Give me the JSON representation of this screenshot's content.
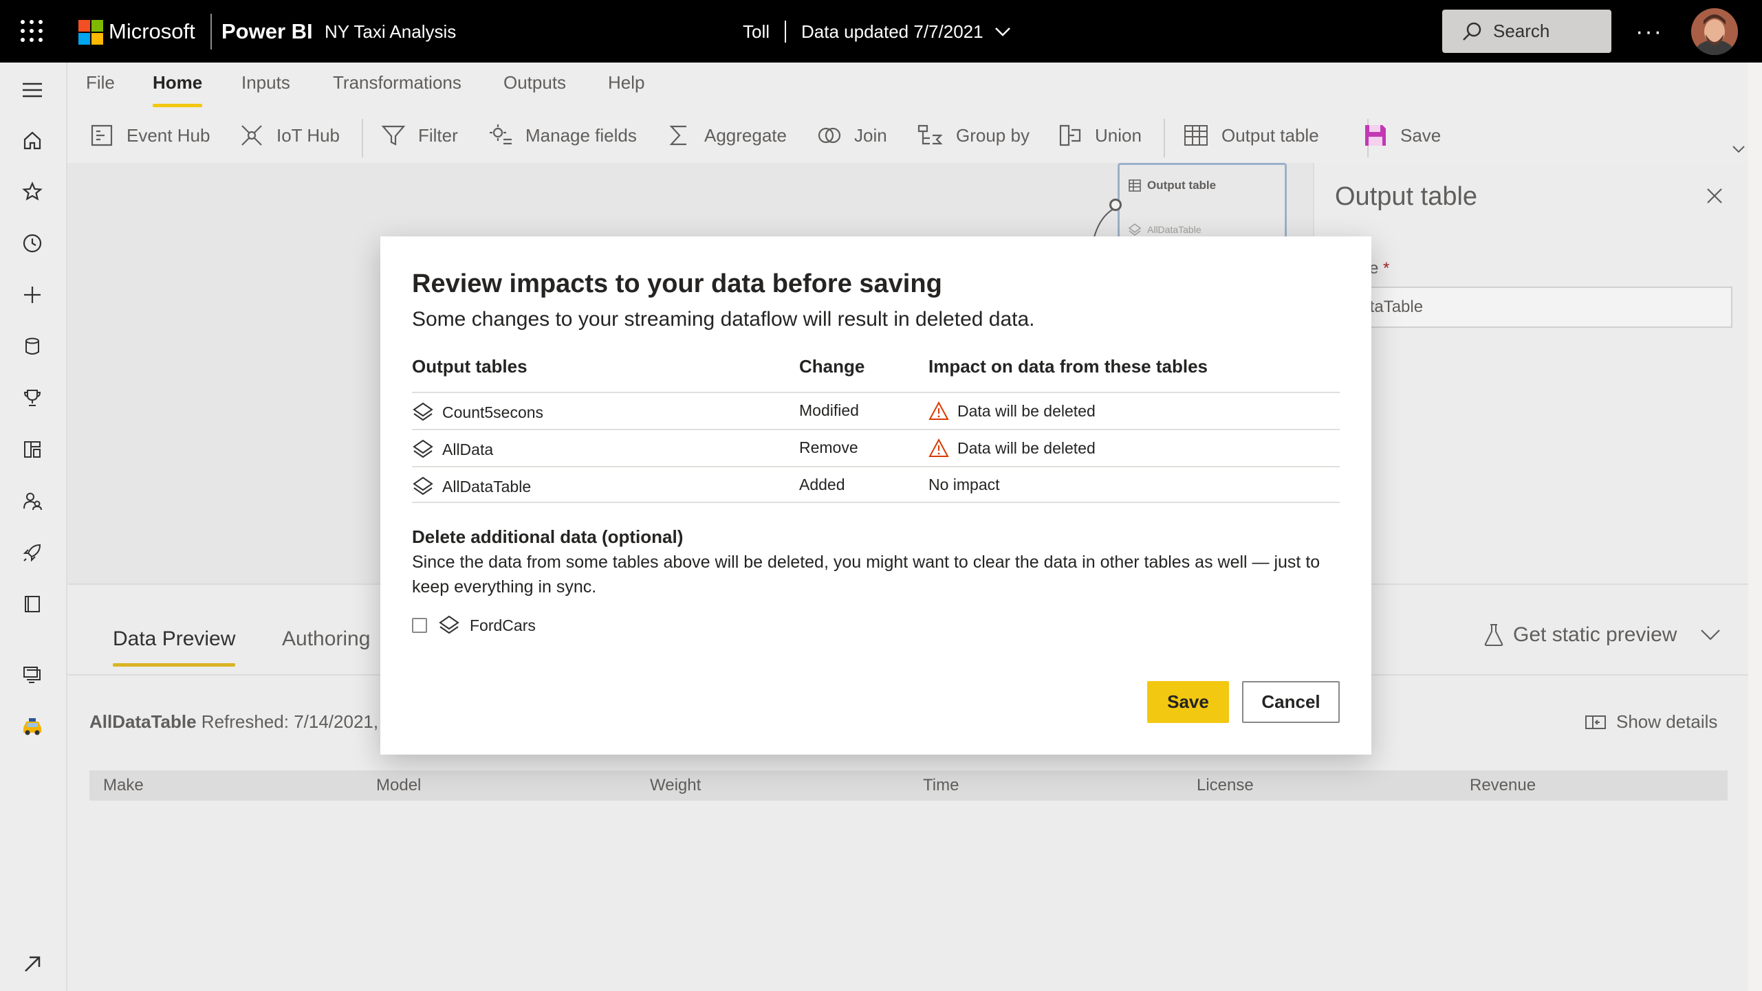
{
  "topbar": {
    "brand": "Microsoft",
    "product": "Power BI",
    "workspace": "NY Taxi Analysis",
    "dataflow": "Toll",
    "data_updated": "Data updated 7/7/2021",
    "search_placeholder": "Search",
    "more": "···"
  },
  "menu": {
    "tabs": [
      "File",
      "Home",
      "Inputs",
      "Transformations",
      "Outputs",
      "Help"
    ],
    "active": "Home"
  },
  "ribbon": {
    "items": [
      "Event Hub",
      "IoT Hub",
      "Filter",
      "Manage fields",
      "Aggregate",
      "Join",
      "Group by",
      "Union",
      "Output table",
      "Save"
    ]
  },
  "canvas": {
    "node_title": "Output table",
    "node_sub": "AllDataTable"
  },
  "sidepane": {
    "title": "Output table",
    "name_label": "e",
    "required_mark": "*",
    "name_value": "DataTable"
  },
  "bottom": {
    "tabs": [
      "Data Preview",
      "Authoring"
    ],
    "static_preview": "Get static preview",
    "table_name": "AllDataTable",
    "refreshed": "Refreshed: 7/14/2021,",
    "show_details": "Show details",
    "columns": [
      "Make",
      "Model",
      "Weight",
      "Time",
      "License",
      "Revenue"
    ]
  },
  "dialog": {
    "title": "Review impacts to your data before saving",
    "subtitle": "Some changes to your streaming dataflow will result in deleted data.",
    "headers": [
      "Output tables",
      "Change",
      "Impact on data from these tables"
    ],
    "rows": [
      {
        "table": "Count5secons",
        "change": "Modified",
        "impact": "Data will be deleted",
        "warning": true
      },
      {
        "table": "AllData",
        "change": "Remove",
        "impact": "Data will be deleted",
        "warning": true
      },
      {
        "table": "AllDataTable",
        "change": "Added",
        "impact": "No impact",
        "warning": false
      }
    ],
    "section_title": "Delete additional data (optional)",
    "section_body": "Since the data from some tables above will be deleted, you might want to clear the data in other tables as well — just to keep everything in sync.",
    "optional_table": "FordCars",
    "save": "Save",
    "cancel": "Cancel"
  },
  "colors": {
    "accent": "#f2c811",
    "warning": "#d83b01",
    "topbar": "#000000"
  }
}
